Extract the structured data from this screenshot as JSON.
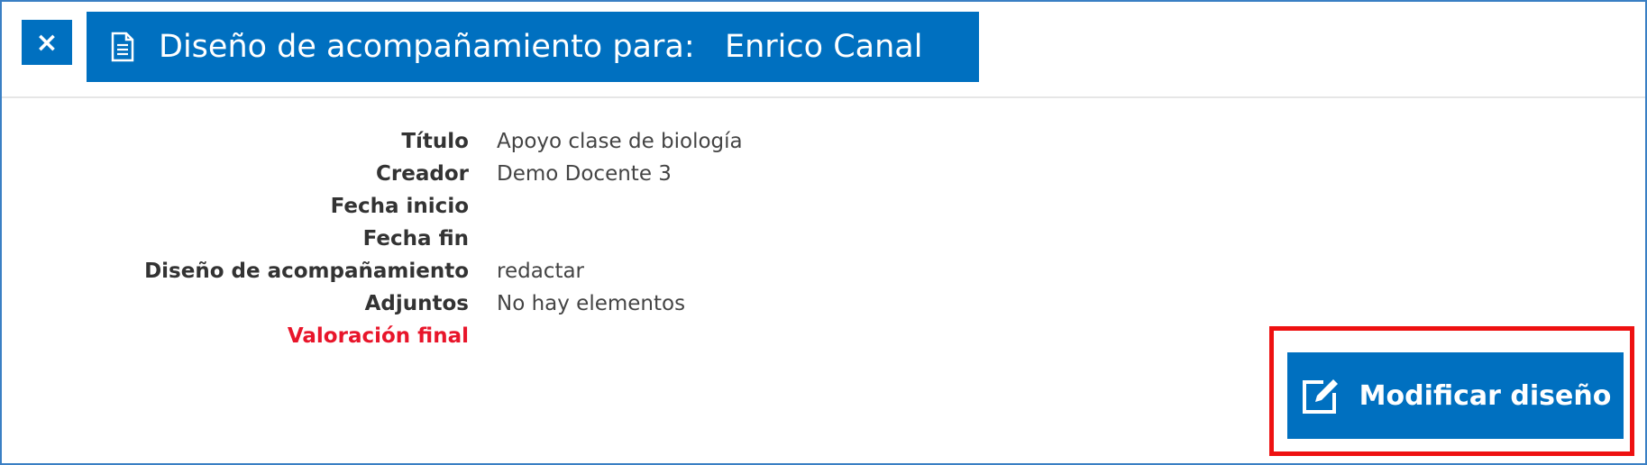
{
  "close_button": {
    "icon": "close-icon",
    "label": "×"
  },
  "header": {
    "icon": "document-icon",
    "title": "Diseño de acompañamiento para:   Enrico Canal"
  },
  "details": [
    {
      "label": "Título",
      "value": "Apoyo clase de biología",
      "emphasis": false
    },
    {
      "label": "Creador",
      "value": "Demo Docente 3",
      "emphasis": false
    },
    {
      "label": "Fecha inicio",
      "value": "",
      "emphasis": false
    },
    {
      "label": "Fecha fin",
      "value": "",
      "emphasis": false
    },
    {
      "label": "Diseño de acompañamiento",
      "value": "redactar",
      "emphasis": false
    },
    {
      "label": "Adjuntos",
      "value": "No hay elementos",
      "emphasis": false
    },
    {
      "label": "Valoración final",
      "value": "",
      "emphasis": true
    }
  ],
  "modify_button": {
    "icon": "edit-icon",
    "label": "Modificar diseño"
  },
  "colors": {
    "primary": "#0070c0",
    "border": "#3a7fc4",
    "required_label": "#e8152a",
    "highlight": "#ee1111"
  }
}
